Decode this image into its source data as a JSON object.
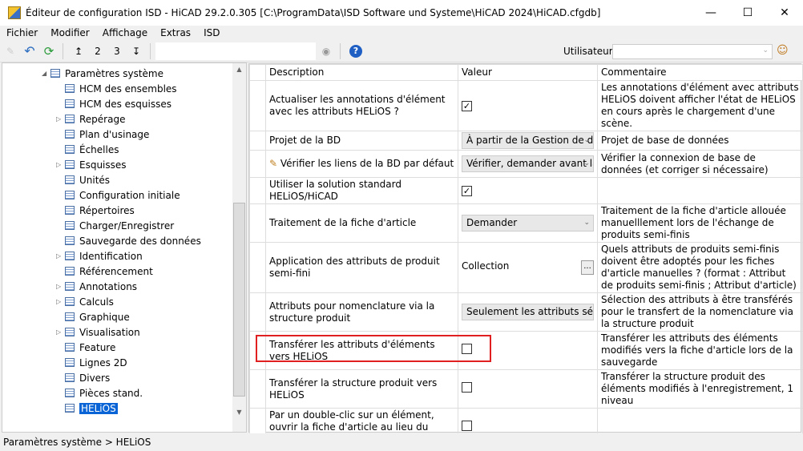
{
  "window": {
    "title": "Éditeur de configuration ISD  - HiCAD 29.2.0.305 [C:\\ProgramData\\ISD Software und Systeme\\HiCAD 2024\\HiCAD.cfgdb]"
  },
  "menu": [
    "Fichier",
    "Modifier",
    "Affichage",
    "Extras",
    "ISD"
  ],
  "toolbar": {
    "user_label": "Utilisateur",
    "user_value": "",
    "level2": "2",
    "level3": "3"
  },
  "tree": {
    "root": "Paramètres système",
    "items": [
      {
        "label": "HCM des ensembles",
        "exp": false
      },
      {
        "label": "HCM des esquisses",
        "exp": false
      },
      {
        "label": "Repérage",
        "exp": true
      },
      {
        "label": "Plan d'usinage",
        "exp": false
      },
      {
        "label": "Échelles",
        "exp": false
      },
      {
        "label": "Esquisses",
        "exp": true
      },
      {
        "label": "Unités",
        "exp": false
      },
      {
        "label": "Configuration initiale",
        "exp": false
      },
      {
        "label": "Répertoires",
        "exp": false
      },
      {
        "label": "Charger/Enregistrer",
        "exp": false
      },
      {
        "label": "Sauvegarde des données",
        "exp": false
      },
      {
        "label": "Identification",
        "exp": true
      },
      {
        "label": "Référencement",
        "exp": false
      },
      {
        "label": "Annotations",
        "exp": true
      },
      {
        "label": "Calculs",
        "exp": true
      },
      {
        "label": "Graphique",
        "exp": false
      },
      {
        "label": "Visualisation",
        "exp": true
      },
      {
        "label": "Feature",
        "exp": false
      },
      {
        "label": "Lignes 2D",
        "exp": false
      },
      {
        "label": "Divers",
        "exp": false
      },
      {
        "label": "Pièces stand.",
        "exp": false
      },
      {
        "label": "HELiOS",
        "exp": false,
        "selected": true
      }
    ]
  },
  "grid": {
    "headers": [
      "Description",
      "Valeur",
      "Commentaire"
    ],
    "rows": [
      {
        "desc": "Actualiser les annotations d'élément avec les attributs HELiOS ?",
        "type": "check",
        "checked": true,
        "comment": "Les annotations d'élément avec attributs HELiOS doivent afficher l'état de HELiOS en cours après le chargement d'une scène.",
        "h": 50
      },
      {
        "desc": "Projet de la BD",
        "type": "select",
        "value": "À partir de la Gestion de documents",
        "comment": "Projet de base de données",
        "h": 23
      },
      {
        "desc": "Vérifier les liens de la BD par défaut",
        "type": "select",
        "value": "Vérifier, demander avant la correction",
        "comment": "Vérifier la connexion de base de données (et corriger si nécessaire)",
        "h": 34,
        "edited": true
      },
      {
        "desc": "Utiliser la solution standard HELiOS/HiCAD",
        "type": "check",
        "checked": true,
        "comment": "",
        "h": 20
      },
      {
        "desc": "Traitement de la fiche d'article",
        "type": "select",
        "value": "Demander",
        "comment": "Traitement de la fiche d'article allouée manuelllement lors de l'échange de produits semi-finis",
        "h": 48
      },
      {
        "desc": "Application des attributs de produit semi-fini",
        "type": "text",
        "value": "Collection",
        "comment": "Quels attributs de produits semi-finis doivent être adoptés pour les fiches d'article manuelles ? (format : Attribut de produits semi-finis ; Attribut d'article)",
        "h": 62
      },
      {
        "desc": "Attributs pour nomenclature via la structure produit",
        "type": "select",
        "value": "Seulement les attributs sélectionnés",
        "comment": "Sélection des attributs à être transférés pour le transfert de la nomenclature via la structure produit",
        "h": 48
      },
      {
        "desc": "Transférer les attributs d'éléments vers HELiOS",
        "type": "check",
        "checked": false,
        "comment": "Transférer les attributs des éléments modifiés vers la fiche d'article lors de la sauvegarde",
        "h": 34
      },
      {
        "desc": "Transférer la structure produit vers HELiOS",
        "type": "check",
        "checked": false,
        "comment": "Transférer la structure produit des éléments modifiés à l'enregistrement, 1 niveau",
        "h": 33
      },
      {
        "desc": "Par un double-clic sur un élément, ouvrir la fiche d'article au lieu du masque des Attributs d'élément",
        "type": "check",
        "checked": false,
        "comment": "",
        "h": 48
      }
    ]
  },
  "status": "Paramètres système > HELiOS"
}
